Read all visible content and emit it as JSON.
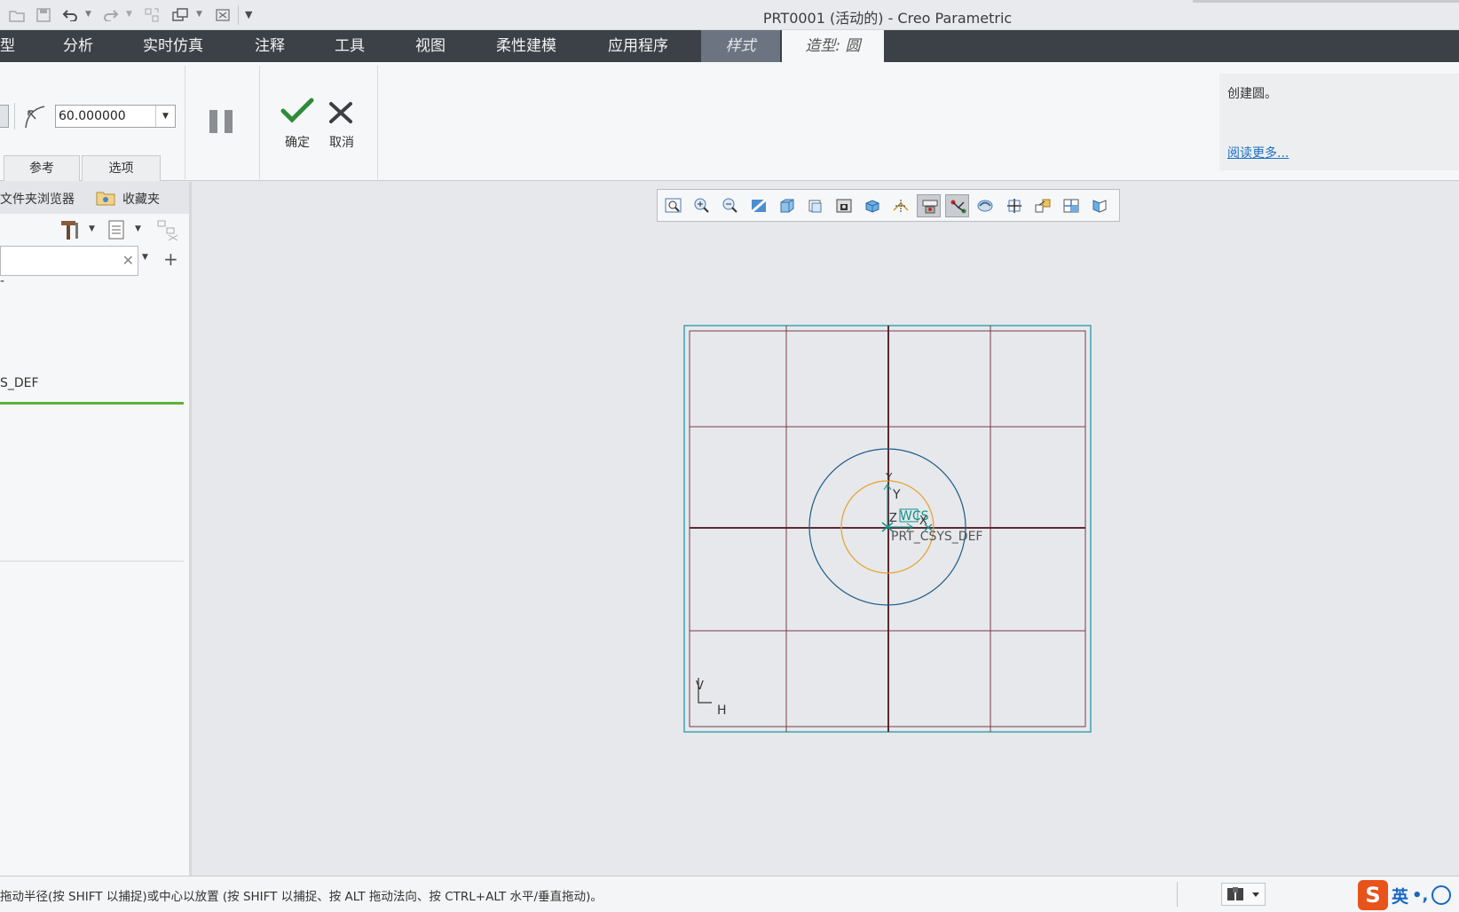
{
  "window": {
    "title": "PRT0001 (活动的) - Creo Parametric"
  },
  "ribbon_tabs": [
    {
      "label": "型",
      "state": "normal"
    },
    {
      "label": "分析",
      "state": "normal"
    },
    {
      "label": "实时仿真",
      "state": "normal"
    },
    {
      "label": "注释",
      "state": "normal"
    },
    {
      "label": "工具",
      "state": "normal"
    },
    {
      "label": "视图",
      "state": "normal"
    },
    {
      "label": "柔性建模",
      "state": "normal"
    },
    {
      "label": "应用程序",
      "state": "normal"
    },
    {
      "label": "样式",
      "state": "style"
    },
    {
      "label": "造型: 圆",
      "state": "active"
    }
  ],
  "dashboard": {
    "radius_value": "60.000000",
    "subtabs": [
      "参考",
      "选项"
    ],
    "ok_label": "确定",
    "cancel_label": "取消"
  },
  "message_panel": {
    "text": "创建圆。",
    "link": "阅读更多..."
  },
  "navigator": {
    "tabs": [
      "文件夹浏览器",
      "收藏夹"
    ],
    "tree_items": [
      {
        "label": "-"
      },
      {
        "label": "S_DEF"
      }
    ]
  },
  "viewport": {
    "labels": {
      "y_axis": "Y",
      "y_small": "Y",
      "wcs": "WCS",
      "csys": "PRT_CSYS_DEF",
      "v": "V",
      "h": "H",
      "z": "Z",
      "x": "X"
    }
  },
  "statusbar": {
    "text": "拖动半径(按 SHIFT 以捕捉)或中心以放置 (按 SHIFT 以捕捉、按 ALT 拖动法向、按 CTRL+ALT 水平/垂直拖动)。"
  },
  "ime": {
    "logo": "S",
    "lang": "英",
    "punct": "•,"
  },
  "colors": {
    "tab_bar": "#3c4147",
    "grid_border": "#3aa6b0",
    "grid_line": "#7a3c45",
    "outer_circle": "#1d5c86",
    "inner_circle": "#e6a12a",
    "csys": "#139287"
  }
}
